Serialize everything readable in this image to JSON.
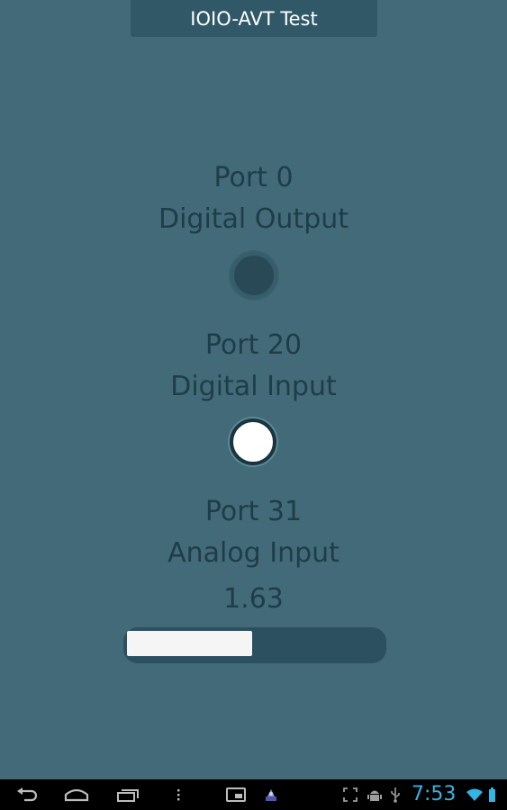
{
  "app": {
    "title": "IOIO-AVT Test"
  },
  "ports": [
    {
      "port_label": "Port 0",
      "type_label": "Digital Output",
      "state": "off"
    },
    {
      "port_label": "Port 20",
      "type_label": "Digital Input",
      "state": "on"
    },
    {
      "port_label": "Port 31",
      "type_label": "Analog Input",
      "value_label": "1.63",
      "level_fraction": 0.49
    }
  ],
  "status_bar": {
    "time": "7:53"
  },
  "colors": {
    "background": "#426a78",
    "title_bar": "#305867",
    "label_text": "#1e3d49",
    "clock": "#33b5e5"
  },
  "icons": [
    "back-icon",
    "home-icon",
    "recent-apps-icon",
    "menu-icon",
    "screenshot-icon",
    "app-notification-icon",
    "fullscreen-icon",
    "android-debug-icon",
    "usb-icon",
    "wifi-icon",
    "battery-icon"
  ]
}
